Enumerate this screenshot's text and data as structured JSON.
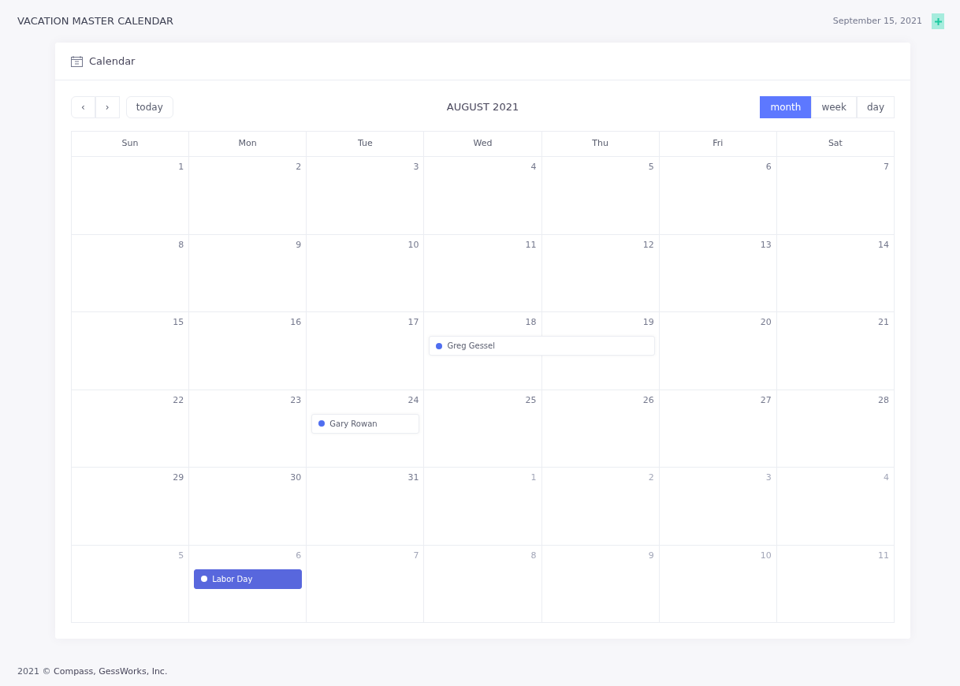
{
  "header": {
    "title": "VACATION MASTER CALENDAR",
    "date": "September 15, 2021"
  },
  "card": {
    "title": "Calendar"
  },
  "toolbar": {
    "prev": "‹",
    "next": "›",
    "today": "today",
    "title": "AUGUST 2021",
    "views": [
      {
        "label": "month",
        "selected": true
      },
      {
        "label": "week",
        "selected": false
      },
      {
        "label": "day",
        "selected": false
      }
    ]
  },
  "weekdays": [
    "Sun",
    "Mon",
    "Tue",
    "Wed",
    "Thu",
    "Fri",
    "Sat"
  ],
  "weeks": [
    {
      "days": [
        {
          "label": "1",
          "other_month": false
        },
        {
          "label": "2",
          "other_month": false
        },
        {
          "label": "3",
          "other_month": false
        },
        {
          "label": "4",
          "other_month": false
        },
        {
          "label": "5",
          "other_month": false
        },
        {
          "label": "6",
          "other_month": false
        },
        {
          "label": "7",
          "other_month": false
        }
      ]
    },
    {
      "days": [
        {
          "label": "8",
          "other_month": false
        },
        {
          "label": "9",
          "other_month": false
        },
        {
          "label": "10",
          "other_month": false
        },
        {
          "label": "11",
          "other_month": false
        },
        {
          "label": "12",
          "other_month": false
        },
        {
          "label": "13",
          "other_month": false
        },
        {
          "label": "14",
          "other_month": false
        }
      ]
    },
    {
      "days": [
        {
          "label": "15",
          "other_month": false
        },
        {
          "label": "16",
          "other_month": false
        },
        {
          "label": "17",
          "other_month": false
        },
        {
          "label": "18",
          "other_month": false,
          "events": [
            {
              "title": "Greg Gessel",
              "kind": "vacation",
              "color": "#4f6ef0",
              "continues": true
            }
          ]
        },
        {
          "label": "19",
          "other_month": false
        },
        {
          "label": "20",
          "other_month": false
        },
        {
          "label": "21",
          "other_month": false
        }
      ]
    },
    {
      "days": [
        {
          "label": "22",
          "other_month": false
        },
        {
          "label": "23",
          "other_month": false
        },
        {
          "label": "24",
          "other_month": false,
          "events": [
            {
              "title": "Gary Rowan",
              "kind": "vacation",
              "color": "#4f6ef0",
              "continues": false
            }
          ]
        },
        {
          "label": "25",
          "other_month": false
        },
        {
          "label": "26",
          "other_month": false
        },
        {
          "label": "27",
          "other_month": false
        },
        {
          "label": "28",
          "other_month": false
        }
      ]
    },
    {
      "days": [
        {
          "label": "29",
          "other_month": false
        },
        {
          "label": "30",
          "other_month": false
        },
        {
          "label": "31",
          "other_month": false
        },
        {
          "label": "1",
          "other_month": true
        },
        {
          "label": "2",
          "other_month": true
        },
        {
          "label": "3",
          "other_month": true
        },
        {
          "label": "4",
          "other_month": true
        }
      ]
    },
    {
      "days": [
        {
          "label": "5",
          "other_month": true
        },
        {
          "label": "6",
          "other_month": true,
          "events": [
            {
              "title": "Labor Day",
              "kind": "holiday",
              "color": "#5867dd",
              "continues": false
            }
          ]
        },
        {
          "label": "7",
          "other_month": true
        },
        {
          "label": "8",
          "other_month": true
        },
        {
          "label": "9",
          "other_month": true
        },
        {
          "label": "10",
          "other_month": true
        },
        {
          "label": "11",
          "other_month": true
        }
      ]
    }
  ],
  "footer": {
    "year": "2021 ©",
    "company": "Compass, GessWorks, Inc."
  }
}
